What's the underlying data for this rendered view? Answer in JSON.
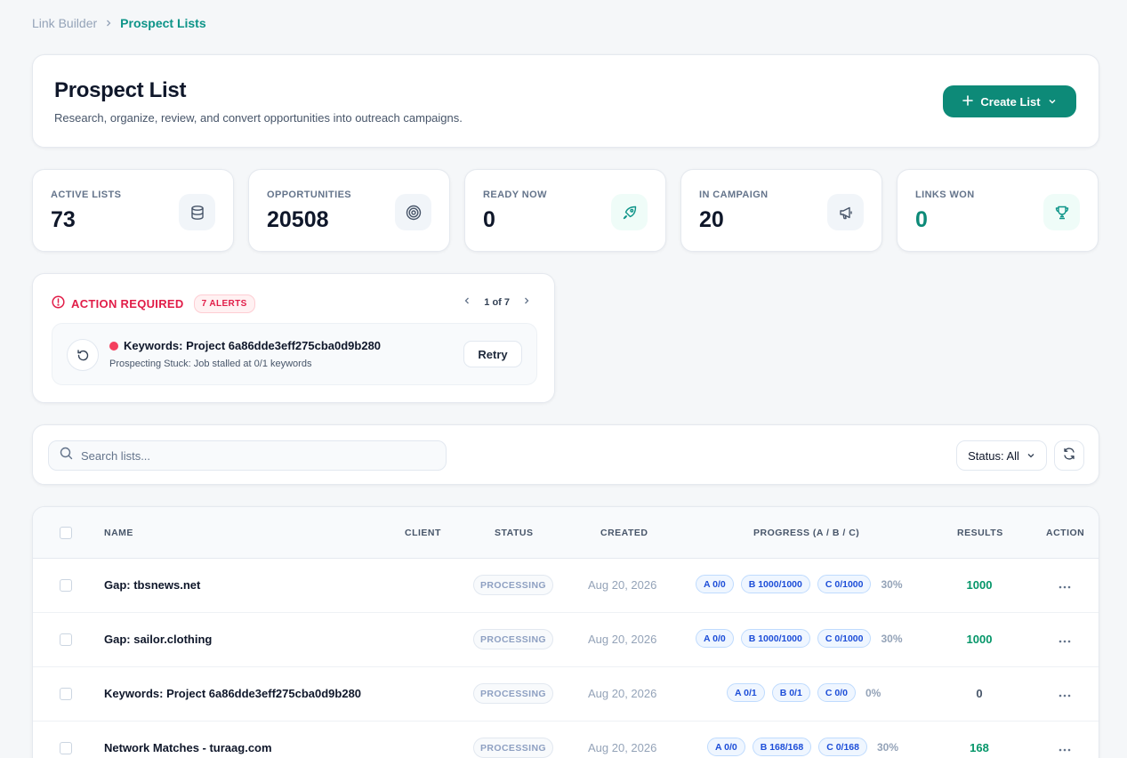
{
  "breadcrumb": {
    "root": "Link Builder",
    "current": "Prospect Lists"
  },
  "header": {
    "title": "Prospect List",
    "subtitle": "Research, organize, review, and convert opportunities into outreach campaigns.",
    "create_label": "Create List"
  },
  "stats": [
    {
      "label": "ACTIVE LISTS",
      "value": "73",
      "icon": "database-icon"
    },
    {
      "label": "OPPORTUNITIES",
      "value": "20508",
      "icon": "target-icon"
    },
    {
      "label": "READY NOW",
      "value": "0",
      "icon": "rocket-icon"
    },
    {
      "label": "IN CAMPAIGN",
      "value": "20",
      "icon": "megaphone-icon"
    },
    {
      "label": "LINKS WON",
      "value": "0",
      "icon": "trophy-icon"
    }
  ],
  "alerts": {
    "title": "ACTION REQUIRED",
    "badge": "7 ALERTS",
    "pager": "1 of 7",
    "item": {
      "title": "Keywords: Project 6a86dde3eff275cba0d9b280",
      "subtitle": "Prospecting Stuck: Job stalled at 0/1 keywords",
      "action": "Retry"
    }
  },
  "toolbar": {
    "search_placeholder": "Search lists...",
    "status_filter": "Status: All"
  },
  "table": {
    "columns": [
      "NAME",
      "CLIENT",
      "STATUS",
      "CREATED",
      "PROGRESS (A / B / C)",
      "RESULTS",
      "ACTION"
    ],
    "rows": [
      {
        "name": "Gap: tbsnews.net",
        "client": "",
        "status": "PROCESSING",
        "created": "Aug 20, 2026",
        "a": "A 0/0",
        "b": "B 1000/1000",
        "c": "C 0/1000",
        "pct": "30%",
        "results": "1000",
        "results_color": "#059669"
      },
      {
        "name": "Gap: sailor.clothing",
        "client": "",
        "status": "PROCESSING",
        "created": "Aug 20, 2026",
        "a": "A 0/0",
        "b": "B 1000/1000",
        "c": "C 0/1000",
        "pct": "30%",
        "results": "1000",
        "results_color": "#059669"
      },
      {
        "name": "Keywords: Project 6a86dde3eff275cba0d9b280",
        "client": "",
        "status": "PROCESSING",
        "created": "Aug 20, 2026",
        "a": "A 0/1",
        "b": "B 0/1",
        "c": "C 0/0",
        "pct": "0%",
        "results": "0",
        "results_color": "#475569"
      },
      {
        "name": "Network Matches - turaag.com",
        "client": "",
        "status": "PROCESSING",
        "created": "Aug 20, 2026",
        "a": "A 0/0",
        "b": "B 168/168",
        "c": "C 0/168",
        "pct": "30%",
        "results": "168",
        "results_color": "#059669"
      }
    ]
  },
  "colors": {
    "accent": "#0d8a78",
    "alert": "#e11d48",
    "progress_badge": "#1d4ed8"
  }
}
